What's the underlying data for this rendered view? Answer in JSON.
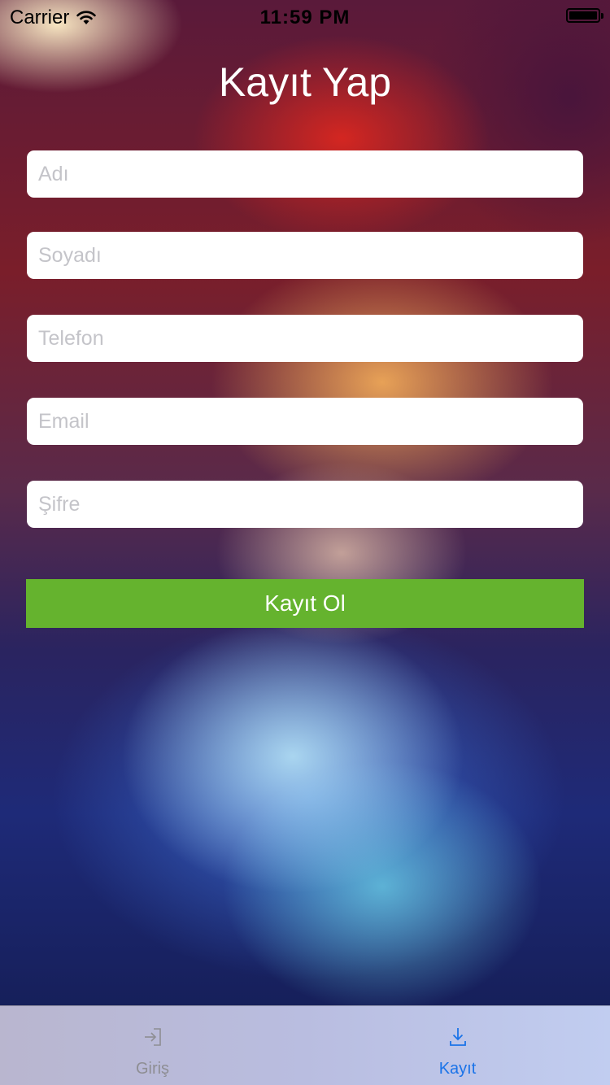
{
  "status_bar": {
    "carrier": "Carrier",
    "time": "11:59 PM",
    "wifi_icon": "wifi-icon",
    "battery_icon": "battery-icon",
    "battery_level": 1.0
  },
  "page": {
    "title": "Kayıt Yap"
  },
  "form": {
    "first_name_placeholder": "Adı",
    "last_name_placeholder": "Soyadı",
    "phone_placeholder": "Telefon",
    "email_placeholder": "Email",
    "password_placeholder": "Şifre",
    "first_name_value": "",
    "last_name_value": "",
    "phone_value": "",
    "email_value": "",
    "password_value": "",
    "submit_label": "Kayıt Ol"
  },
  "tab_bar": {
    "tabs": [
      {
        "label": "Giriş",
        "icon": "sign-in-icon",
        "selected": false
      },
      {
        "label": "Kayıt",
        "icon": "download-icon",
        "selected": true
      }
    ]
  },
  "colors": {
    "submit_button": "#65b32e",
    "tab_selected": "#1a73e8",
    "tab_unselected": "#8e8e93"
  }
}
